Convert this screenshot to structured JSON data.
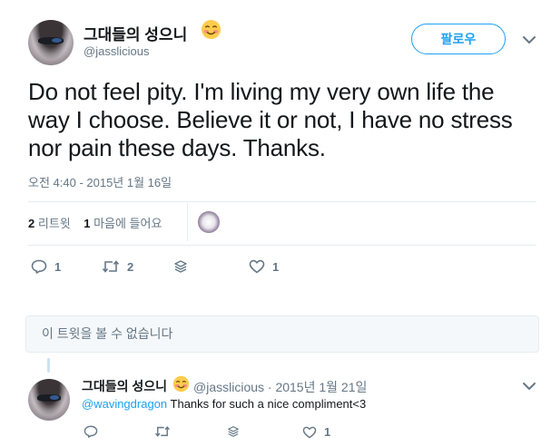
{
  "main_tweet": {
    "display_name": "그대들의 성으니",
    "handle": "@jasslicious",
    "follow_label": "팔로우",
    "text": "Do not feel pity. I'm living my very own life the way I choose. Believe it or not, I have no stress nor pain these days. Thanks.",
    "timestamp": "오전 4:40 - 2015년 1월 16일",
    "stats": {
      "retweets_count": "2",
      "retweets_label": "리트윗",
      "likes_count": "1",
      "likes_label": "마음에 들어요"
    },
    "actions": {
      "reply_count": "1",
      "retweet_count": "2",
      "like_count": "1"
    }
  },
  "unavailable_notice": "이 트윗을 볼 수 없습니다",
  "reply_tweet": {
    "display_name": "그대들의 성으니",
    "meta": "@jasslicious · 2015년 1월 21일",
    "mention": "@wavingdragon",
    "text": " Thanks for such a nice compliment<3",
    "actions": {
      "like_count": "1"
    }
  },
  "colors": {
    "accent": "#1da1f2",
    "secondary_text": "#657786",
    "divider": "#e6ecf0"
  },
  "icons": [
    "chevron-down-icon",
    "reply-icon",
    "retweet-icon",
    "stack-icon",
    "heart-icon",
    "smiling-face-emoji-icon"
  ]
}
